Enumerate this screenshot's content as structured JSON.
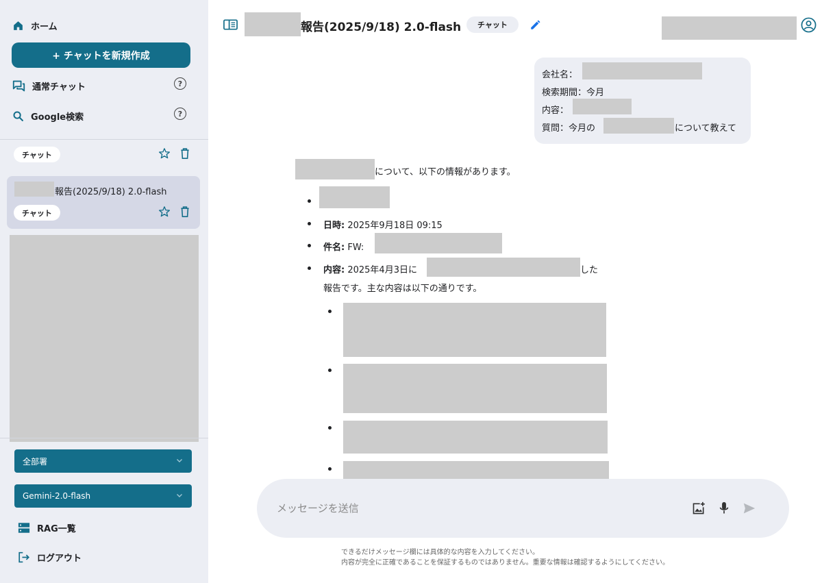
{
  "sidebar": {
    "home_label": "ホーム",
    "new_chat_label": "+ チャットを新規作成",
    "normal_chat_label": "通常チャット",
    "google_search_label": "Google検索",
    "help_glyph": "?",
    "history": [
      {
        "badge": "チャット"
      },
      {
        "title": "報告(2025/9/18) 2.0-flash",
        "badge": "チャット"
      }
    ],
    "department_select": "全部署",
    "model_select": "Gemini-2.0-flash",
    "rag_list_label": "RAG一覧",
    "logout_label": "ログアウト"
  },
  "header": {
    "title": "報告(2025/9/18) 2.0-flash",
    "chip": "チャット"
  },
  "user_message": {
    "line1": "会社名：",
    "line2": "検索期間：今月",
    "line3": "内容：",
    "line4_prefix": "質問：今月の",
    "line4_suffix": "について教えて"
  },
  "response": {
    "intro": "について、以下の情報があります。",
    "date_label": "日時:",
    "date_value": " 2025年9月18日 09:15",
    "subject_label": "件名:",
    "subject_value": " FW:",
    "content_label": "内容:",
    "content_value": " 2025年4月3日に",
    "content_suffix": "した",
    "content_line2": "報告です。主な内容は以下の通りです。"
  },
  "input": {
    "placeholder": "メッセージを送信"
  },
  "disclaimer": {
    "line1": "できるだけメッセージ欄には具体的な内容を入力してください。",
    "line2": "内容が完全に正確であることを保証するものではありません。重要な情報は確認するようにしてください。"
  },
  "colors": {
    "accent": "#146e8a",
    "sidebar_bg": "#eceef4",
    "active_item": "#d5d8e6",
    "edit_icon": "#1a73e8",
    "user_icon": "#146e8a"
  }
}
